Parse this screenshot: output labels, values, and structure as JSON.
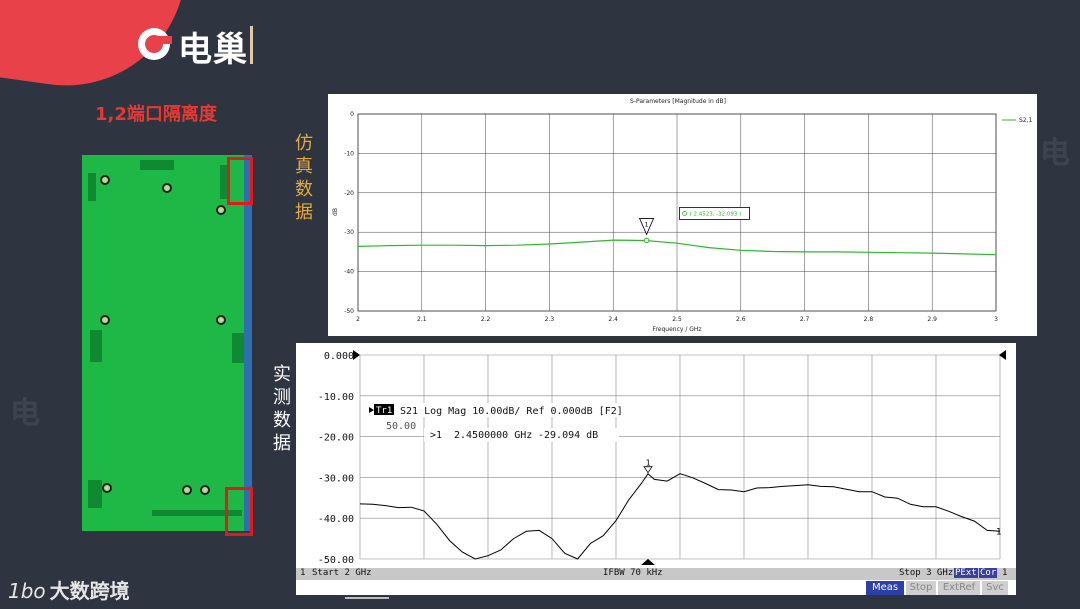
{
  "brand": {
    "name": "电巢",
    "footer": "大数跨境",
    "footer_mark": "1bo"
  },
  "slide": {
    "title": "1,2端口隔离度"
  },
  "labels": {
    "sim": [
      "仿",
      "真",
      "数",
      "据"
    ],
    "meas": [
      "实",
      "测",
      "数",
      "据"
    ]
  },
  "colors": {
    "accent": "#e8414a",
    "sim_trace": "#2db82d",
    "meas_trace": "#000000",
    "pcb": "#1db845",
    "highlight": "#e01b1b",
    "label_gold": "#e6a93c",
    "label_white": "#ffffff"
  },
  "sim_chart": {
    "title": "S-Parameters [Magnitude in dB]",
    "xlabel": "Frequency / GHz",
    "ylabel": "dB",
    "legend": "S2,1",
    "marker_label": "( 2.4523, -32.093 )",
    "marker_id": "1",
    "x_ticks": [
      "2",
      "2.1",
      "2.2",
      "2.3",
      "2.4",
      "2.5",
      "2.6",
      "2.7",
      "2.8",
      "2.9",
      "3"
    ],
    "y_ticks": [
      "0",
      "-10",
      "-20",
      "-30",
      "-40",
      "-50"
    ]
  },
  "meas_chart": {
    "header": "S21 Log Mag 10.00dB/ Ref 0.000dB [F2]",
    "trace_tag": "Tr1",
    "sub_value": "50.00",
    "marker_readout_id": ">1",
    "marker_readout_freq": "2.4500000 GHz",
    "marker_readout_val": "-29.094 dB",
    "marker_id": "1",
    "end_label": "1",
    "y_ticks": [
      "0.000",
      "-10.00",
      "-20.00",
      "-30.00",
      "-40.00",
      "-50.00"
    ],
    "status_left_num": "1",
    "status_start": "Start 2 GHz",
    "status_ifbw": "IFBW 70 kHz",
    "status_stop": "Stop 3 GHz",
    "status_pext": "PExt",
    "status_cor": "Cor",
    "status_end": "1"
  },
  "softkeys": [
    "Meas",
    "Stop",
    "ExtRef",
    "Svc"
  ],
  "chart_data": [
    {
      "type": "line",
      "title": "S-Parameters [Magnitude in dB]",
      "xlabel": "Frequency / GHz",
      "ylabel": "dB",
      "xlim": [
        2,
        3
      ],
      "ylim": [
        -50,
        0
      ],
      "grid": true,
      "legend": "top-right",
      "series": [
        {
          "name": "S2,1",
          "x": [
            2.0,
            2.05,
            2.1,
            2.15,
            2.2,
            2.25,
            2.3,
            2.35,
            2.4,
            2.45,
            2.5,
            2.55,
            2.6,
            2.65,
            2.7,
            2.75,
            2.8,
            2.85,
            2.9,
            2.95,
            3.0
          ],
          "y": [
            -33.6,
            -33.4,
            -33.3,
            -33.3,
            -33.4,
            -33.3,
            -33.0,
            -32.5,
            -32.0,
            -32.1,
            -32.8,
            -33.9,
            -34.6,
            -34.9,
            -35.0,
            -35.0,
            -35.1,
            -35.2,
            -35.3,
            -35.5,
            -35.7
          ]
        }
      ],
      "annotations": [
        {
          "x": 2.4523,
          "y": -32.093,
          "text": "( 2.4523, -32.093 )"
        }
      ]
    },
    {
      "type": "line",
      "title": "S21 Log Mag 10.00dB/ Ref 0.000dB [F2]",
      "xlabel": "",
      "ylabel": "",
      "xlim": [
        2,
        3
      ],
      "ylim": [
        -50,
        0
      ],
      "grid": true,
      "series": [
        {
          "name": "S21",
          "x": [
            2.0,
            2.02,
            2.04,
            2.06,
            2.08,
            2.1,
            2.12,
            2.14,
            2.16,
            2.18,
            2.2,
            2.22,
            2.24,
            2.26,
            2.28,
            2.3,
            2.32,
            2.34,
            2.36,
            2.38,
            2.4,
            2.42,
            2.44,
            2.45,
            2.46,
            2.48,
            2.5,
            2.52,
            2.54,
            2.56,
            2.58,
            2.6,
            2.62,
            2.64,
            2.66,
            2.68,
            2.7,
            2.72,
            2.74,
            2.76,
            2.78,
            2.8,
            2.82,
            2.84,
            2.86,
            2.88,
            2.9,
            2.92,
            2.94,
            2.96,
            2.98,
            3.0
          ],
          "y": [
            -36.5,
            -36.6,
            -36.9,
            -37.4,
            -37.3,
            -38.2,
            -41.5,
            -45.5,
            -48.3,
            -50.0,
            -49.2,
            -47.8,
            -45.0,
            -43.2,
            -43.0,
            -45.0,
            -48.6,
            -50.0,
            -46.2,
            -44.3,
            -40.6,
            -35.5,
            -31.4,
            -29.1,
            -30.5,
            -30.9,
            -29.1,
            -30.1,
            -31.5,
            -33.0,
            -33.1,
            -33.5,
            -32.6,
            -32.5,
            -32.2,
            -32.0,
            -31.8,
            -32.2,
            -32.3,
            -32.9,
            -33.5,
            -33.5,
            -34.8,
            -35.1,
            -36.6,
            -37.2,
            -37.2,
            -38.3,
            -39.6,
            -40.7,
            -43.0,
            -43.2
          ]
        }
      ],
      "annotations": [
        {
          "x": 2.45,
          "y": -29.094,
          "text": "2.4500000 GHz -29.094 dB"
        }
      ]
    }
  ]
}
